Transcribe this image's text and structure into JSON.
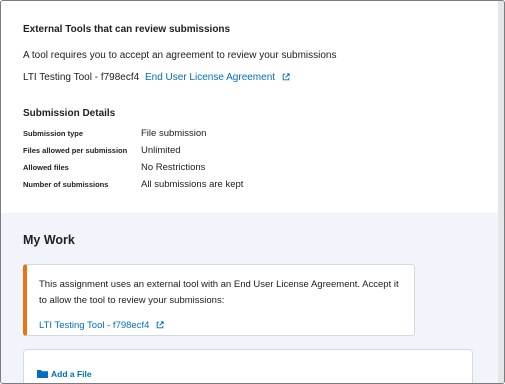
{
  "external_tools": {
    "heading": "External Tools that can review submissions",
    "requirement_text": "A tool requires you to accept an agreement to review your submissions",
    "tool_name": "LTI Testing Tool - f798ecf4",
    "eula_link": "End User License Agreement"
  },
  "submission_details": {
    "heading": "Submission Details",
    "rows": [
      {
        "label": "Submission type",
        "value": "File submission"
      },
      {
        "label": "Files allowed per submission",
        "value": "Unlimited"
      },
      {
        "label": "Allowed files",
        "value": "No Restrictions"
      },
      {
        "label": "Number of submissions",
        "value": "All submissions are kept"
      }
    ]
  },
  "my_work": {
    "heading": "My Work",
    "notice_text": "This assignment uses an external tool with an End User License Agreement. Accept it to allow the tool to review your submissions:",
    "notice_link": "LTI Testing Tool - f798ecf4",
    "add_file_label": "Add a File"
  },
  "colors": {
    "link": "#006fbf",
    "accent_warning": "#e87511",
    "panel_bg": "#f1f5fb"
  }
}
